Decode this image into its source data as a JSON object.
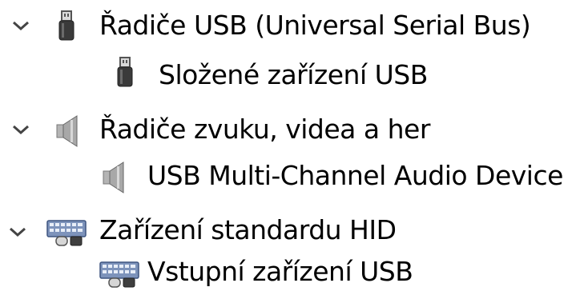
{
  "tree": {
    "categories": [
      {
        "label": "Řadiče USB (Universal Serial Bus)",
        "icon": "usb-plug-icon",
        "expanded": true,
        "children": [
          {
            "label": "Složené zařízení USB",
            "icon": "usb-plug-icon"
          }
        ]
      },
      {
        "label": "Řadiče zvuku, videa a her",
        "icon": "speaker-icon",
        "expanded": true,
        "children": [
          {
            "label": "USB Multi-Channel Audio Device",
            "icon": "speaker-icon"
          }
        ]
      },
      {
        "label": "Zařízení standardu HID",
        "icon": "hid-keyboard-icon",
        "expanded": true,
        "children": [
          {
            "label": "Vstupní zařízení USB",
            "icon": "hid-keyboard-icon"
          }
        ]
      }
    ]
  },
  "colors": {
    "chevron": "#444444",
    "text": "#000000",
    "speaker_gray": "#9a9a9a",
    "keyboard_blue": "#6f86b0"
  }
}
